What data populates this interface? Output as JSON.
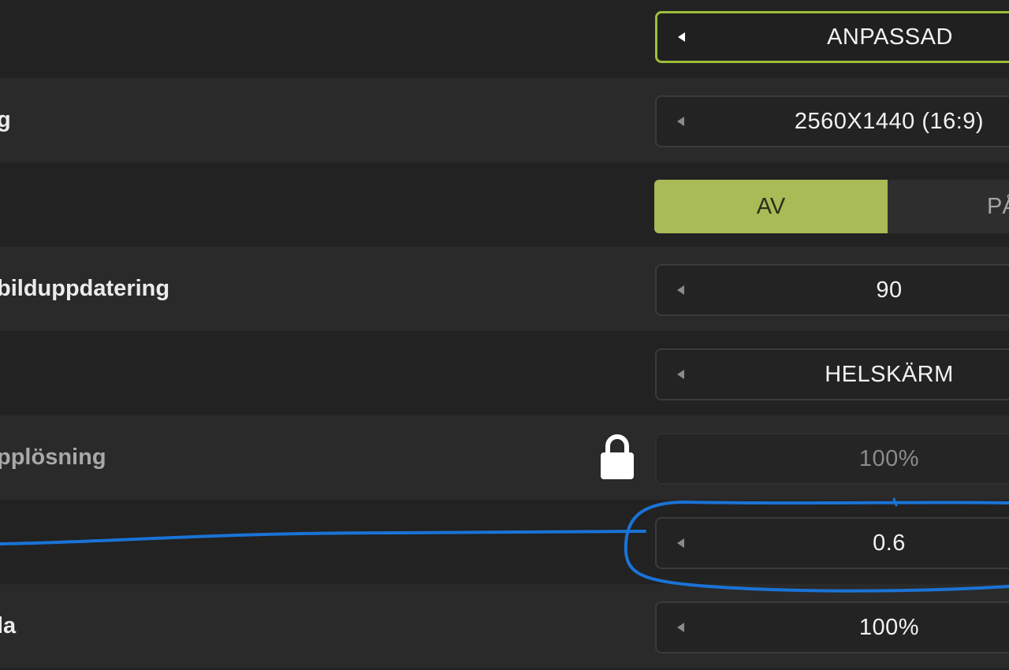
{
  "settings": {
    "rows": [
      {
        "label": "",
        "value": "ANPASSAD",
        "kind": "selector",
        "state": "focused"
      },
      {
        "label": "g",
        "value": "2560X1440 (16:9)",
        "kind": "selector"
      },
      {
        "label": "",
        "kind": "toggle",
        "options": [
          "AV",
          "PÅ"
        ],
        "selected": "AV"
      },
      {
        "label": "bilduppdatering",
        "value": "90",
        "kind": "selector"
      },
      {
        "label": "",
        "value": "HELSKÄRM",
        "kind": "selector"
      },
      {
        "label": "pplösning",
        "value": "100%",
        "kind": "selector",
        "state": "locked",
        "icon": "lock-icon"
      },
      {
        "label": "",
        "value": "0.6",
        "kind": "selector",
        "annotated": true
      },
      {
        "label": "la",
        "value": "100%",
        "kind": "selector"
      }
    ]
  },
  "colors": {
    "accent": "#9cbd3c",
    "toggle_active": "#a8bb56",
    "annotation": "#1a73d6"
  }
}
